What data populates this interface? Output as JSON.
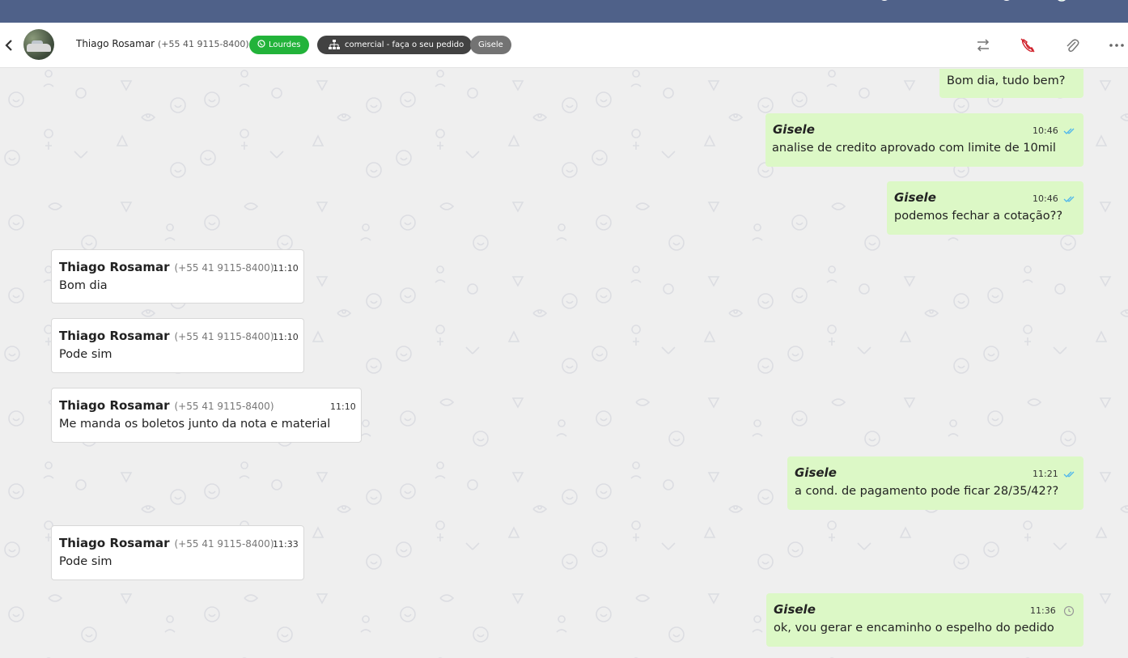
{
  "header": {
    "contact_name": "Thiago Rosamar",
    "contact_phone": "(+55 41 9115-8400)",
    "tags": [
      {
        "label": "Lourdes",
        "color": "#22b33a",
        "icon": "whatsapp-icon"
      },
      {
        "label": "comercial - faça o seu pedido",
        "color": "#424242",
        "icon": "sitemap-icon"
      },
      {
        "label": "Gisele",
        "color": "#737373"
      }
    ],
    "actions": [
      "transfer-icon",
      "end-call-icon",
      "attachment-icon",
      "more-icon"
    ]
  },
  "messages": [
    {
      "direction": "out",
      "sender": "",
      "time": "",
      "text": "Bom dia, tudo bem?",
      "status": "read"
    },
    {
      "direction": "out",
      "sender": "Gisele",
      "time": "10:46",
      "text": "analise de credito aprovado com limite de 10mil",
      "status": "read"
    },
    {
      "direction": "out",
      "sender": "Gisele",
      "time": "10:46",
      "text": "podemos fechar a cotação??",
      "status": "read"
    },
    {
      "direction": "in",
      "sender": "Thiago Rosamar",
      "phone": "(+55 41 9115-8400)",
      "time": "11:10",
      "text": "Bom dia"
    },
    {
      "direction": "in",
      "sender": "Thiago Rosamar",
      "phone": "(+55 41 9115-8400)",
      "time": "11:10",
      "text": "Pode sim"
    },
    {
      "direction": "in",
      "sender": "Thiago Rosamar",
      "phone": "(+55 41 9115-8400)",
      "time": "11:10",
      "text": "Me manda os boletos junto da nota e material"
    },
    {
      "direction": "out",
      "sender": "Gisele",
      "time": "11:21",
      "text": "a cond. de pagamento pode ficar 28/35/42??",
      "status": "read"
    },
    {
      "direction": "in",
      "sender": "Thiago Rosamar",
      "phone": "(+55 41 9115-8400)",
      "time": "11:33",
      "text": "Pode sim"
    },
    {
      "direction": "out",
      "sender": "Gisele",
      "time": "11:36",
      "text": "ok, vou gerar e encaminho o espelho do pedido",
      "status": "pending"
    }
  ],
  "colors": {
    "topbar": "#4f6189",
    "outgoing_bubble": "#dcf8c6",
    "incoming_bubble": "#ffffff",
    "read_tick": "#4fb6ec"
  }
}
